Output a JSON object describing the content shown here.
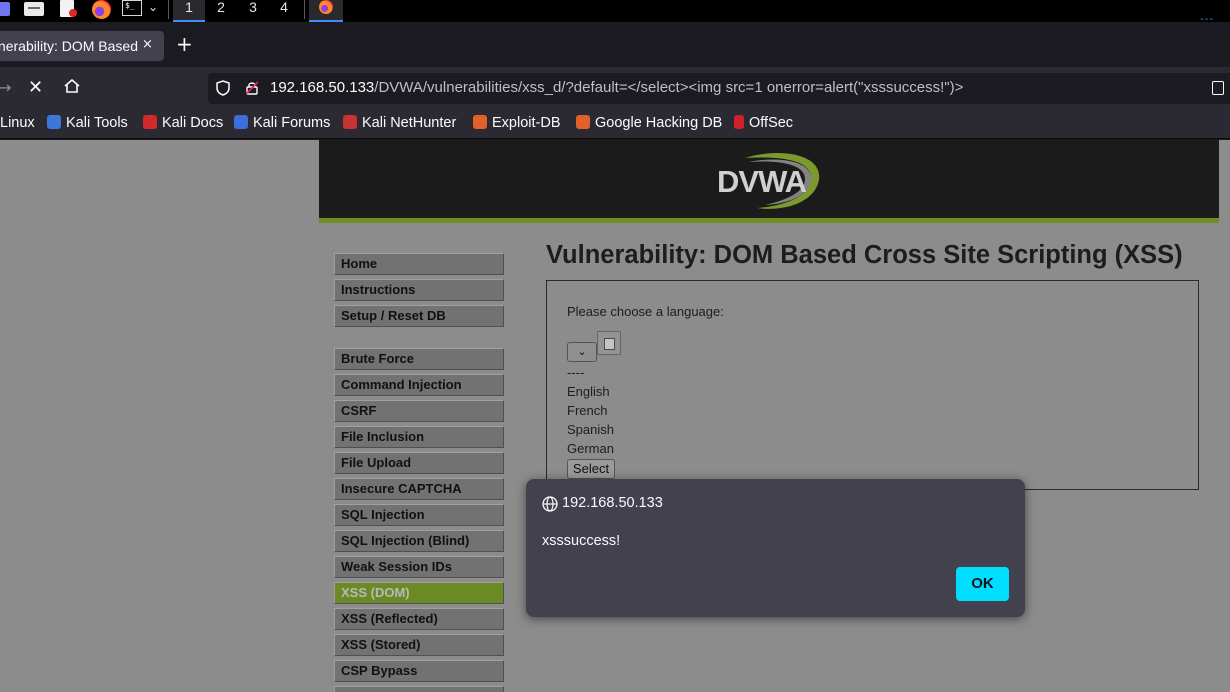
{
  "taskbar": {
    "workspaces": [
      "1",
      "2",
      "3",
      "4"
    ],
    "active_workspace": "1",
    "icons": [
      "app-launcher-icon",
      "file-manager-icon",
      "text-editor-icon",
      "firefox-icon",
      "terminal-icon",
      "chevron-down-icon"
    ],
    "terminal_glyph": "$_"
  },
  "browser": {
    "tab_title": "Vulnerability: DOM Based",
    "tab_close": "×",
    "new_tab": "+",
    "url_host": "192.168.50.133",
    "url_path": "/DVWA/vulnerabilities/xss_d/?default=</select><img src=1 onerror=alert(\"xsssuccess!\")>",
    "bookmarks": [
      {
        "label": "Linux",
        "icon": "kali-icon",
        "color": "#2b2a33"
      },
      {
        "label": "Kali Tools",
        "icon": "kali-tools-icon",
        "color": "#3b79d8"
      },
      {
        "label": "Kali Docs",
        "icon": "kali-docs-icon",
        "color": "#d02a2a"
      },
      {
        "label": "Kali Forums",
        "icon": "kali-forums-icon",
        "color": "#3a6ed8"
      },
      {
        "label": "Kali NetHunter",
        "icon": "nethunter-icon",
        "color": "#c83232"
      },
      {
        "label": "Exploit-DB",
        "icon": "exploit-db-icon",
        "color": "#e0622a"
      },
      {
        "label": "Google Hacking DB",
        "icon": "ghdb-icon",
        "color": "#e0622a"
      },
      {
        "label": "OffSec",
        "icon": "offsec-icon",
        "color": "#d0202a"
      }
    ]
  },
  "dvwa": {
    "logo": "DVWA",
    "title": "Vulnerability: DOM Based Cross Site Scripting (XSS)",
    "menu": [
      {
        "label": "Home",
        "selected": false
      },
      {
        "label": "Instructions",
        "selected": false
      },
      {
        "label": "Setup / Reset DB",
        "selected": false
      },
      {
        "label": "Brute Force",
        "selected": false
      },
      {
        "label": "Command Injection",
        "selected": false
      },
      {
        "label": "CSRF",
        "selected": false
      },
      {
        "label": "File Inclusion",
        "selected": false
      },
      {
        "label": "File Upload",
        "selected": false
      },
      {
        "label": "Insecure CAPTCHA",
        "selected": false
      },
      {
        "label": "SQL Injection",
        "selected": false
      },
      {
        "label": "SQL Injection (Blind)",
        "selected": false
      },
      {
        "label": "Weak Session IDs",
        "selected": false
      },
      {
        "label": "XSS (DOM)",
        "selected": true
      },
      {
        "label": "XSS (Reflected)",
        "selected": false
      },
      {
        "label": "XSS (Stored)",
        "selected": false
      },
      {
        "label": "CSP Bypass",
        "selected": false
      }
    ],
    "prompt": "Please choose a language:",
    "select_value": "",
    "options": [
      "----",
      "English",
      "French",
      "Spanish",
      "German"
    ],
    "select_button": "Select"
  },
  "alert": {
    "origin": "192.168.50.133",
    "message": "xsssuccess!",
    "ok_label": "OK"
  },
  "colors": {
    "accent": "#00ddff",
    "dvwa_green": "#6b8a26",
    "page_bg": "#8c8c8c"
  }
}
